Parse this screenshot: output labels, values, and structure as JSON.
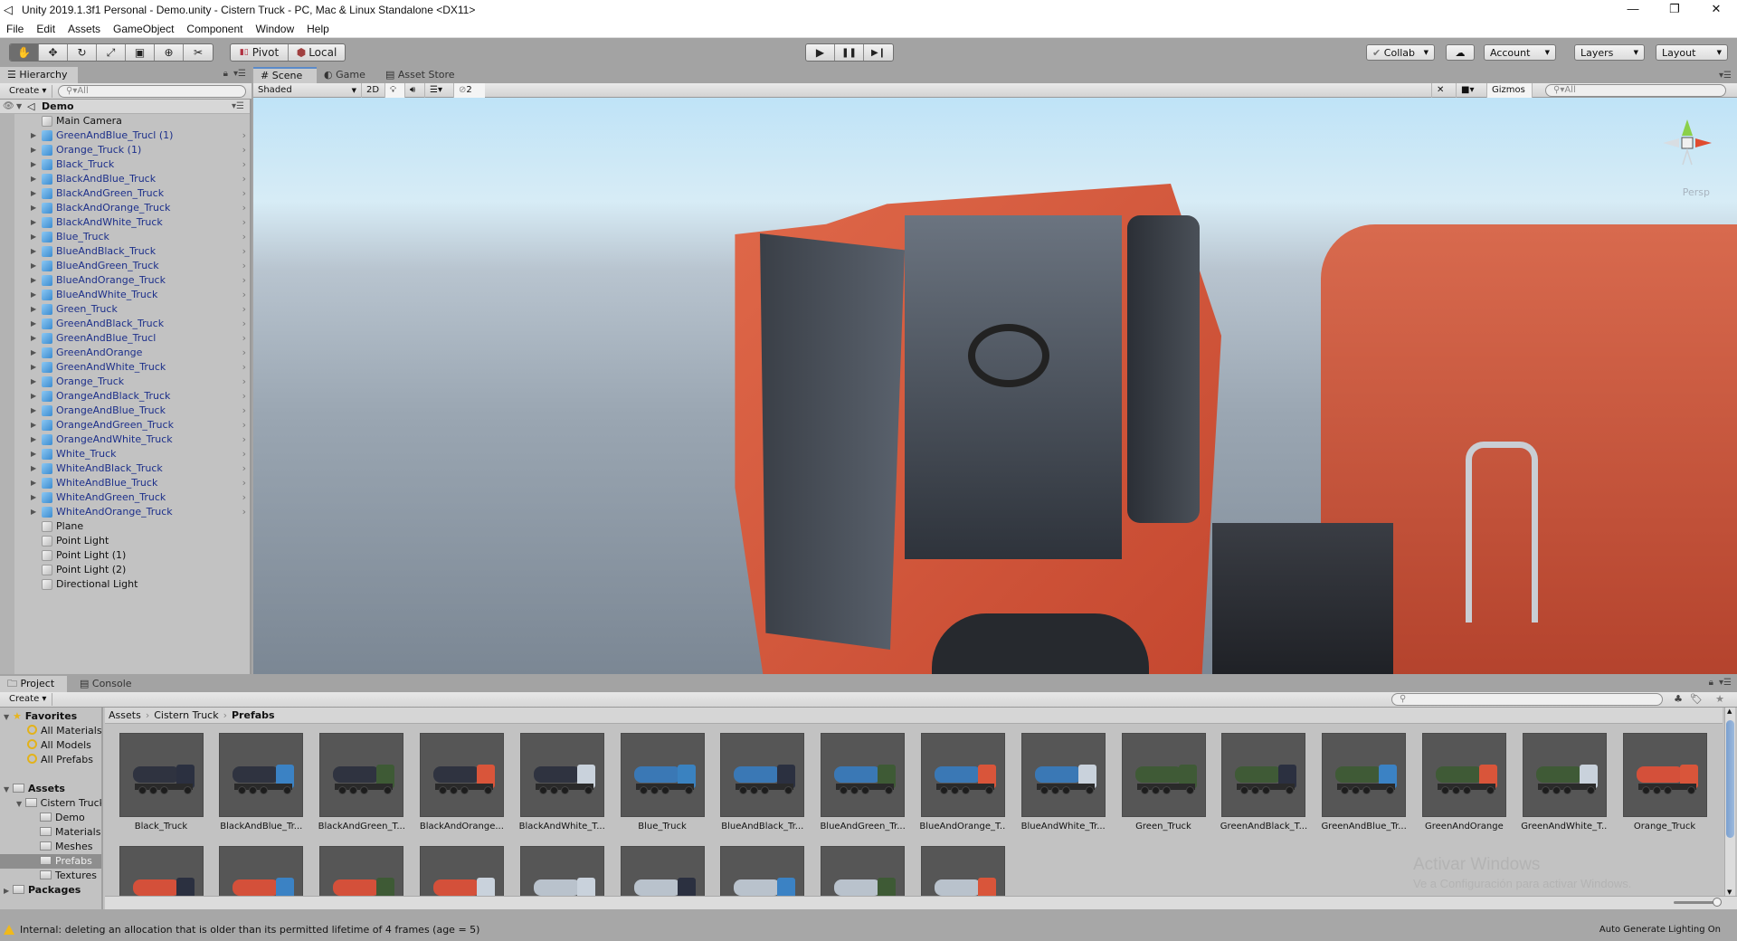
{
  "window": {
    "title": "Unity 2019.1.3f1 Personal - Demo.unity - Cistern Truck - PC, Mac & Linux Standalone <DX11>",
    "controls": {
      "minimize": "—",
      "restore": "❐",
      "close": "✕"
    }
  },
  "menu": [
    "File",
    "Edit",
    "Assets",
    "GameObject",
    "Component",
    "Window",
    "Help"
  ],
  "toolbar": {
    "tools": [
      {
        "name": "hand-tool",
        "glyph": "✋",
        "active": true
      },
      {
        "name": "move-tool",
        "glyph": "✥",
        "active": false
      },
      {
        "name": "rotate-tool",
        "glyph": "↻",
        "active": false
      },
      {
        "name": "scale-tool",
        "glyph": "⤢",
        "active": false
      },
      {
        "name": "rect-tool",
        "glyph": "▣",
        "active": false
      },
      {
        "name": "transform-tool",
        "glyph": "⊕",
        "active": false
      },
      {
        "name": "custom-tool",
        "glyph": "✂",
        "active": false
      }
    ],
    "pivot_label": "Pivot",
    "local_label": "Local",
    "play": {
      "play": "▶",
      "pause": "❚❚",
      "step": "▶❙"
    },
    "collab_label": "Collab",
    "cloud_glyph": "☁",
    "account_label": "Account",
    "layers_label": "Layers",
    "layout_label": "Layout"
  },
  "hierarchy": {
    "tab_label": "Hierarchy",
    "create_label": "Create",
    "search_placeholder": "All",
    "scene_name": "Demo",
    "items": [
      {
        "label": "Main Camera",
        "prefab": false,
        "expandable": false
      },
      {
        "label": "GreenAndBlue_Trucl (1)",
        "prefab": true,
        "expandable": true
      },
      {
        "label": "Orange_Truck (1)",
        "prefab": true,
        "expandable": true
      },
      {
        "label": "Black_Truck",
        "prefab": true,
        "expandable": true
      },
      {
        "label": "BlackAndBlue_Truck",
        "prefab": true,
        "expandable": true
      },
      {
        "label": "BlackAndGreen_Truck",
        "prefab": true,
        "expandable": true
      },
      {
        "label": "BlackAndOrange_Truck",
        "prefab": true,
        "expandable": true
      },
      {
        "label": "BlackAndWhite_Truck",
        "prefab": true,
        "expandable": true
      },
      {
        "label": "Blue_Truck",
        "prefab": true,
        "expandable": true
      },
      {
        "label": "BlueAndBlack_Truck",
        "prefab": true,
        "expandable": true
      },
      {
        "label": "BlueAndGreen_Truck",
        "prefab": true,
        "expandable": true
      },
      {
        "label": "BlueAndOrange_Truck",
        "prefab": true,
        "expandable": true
      },
      {
        "label": "BlueAndWhite_Truck",
        "prefab": true,
        "expandable": true
      },
      {
        "label": "Green_Truck",
        "prefab": true,
        "expandable": true
      },
      {
        "label": "GreenAndBlack_Truck",
        "prefab": true,
        "expandable": true
      },
      {
        "label": "GreenAndBlue_Trucl",
        "prefab": true,
        "expandable": true
      },
      {
        "label": "GreenAndOrange",
        "prefab": true,
        "expandable": true
      },
      {
        "label": "GreenAndWhite_Truck",
        "prefab": true,
        "expandable": true
      },
      {
        "label": "Orange_Truck",
        "prefab": true,
        "expandable": true
      },
      {
        "label": "OrangeAndBlack_Truck",
        "prefab": true,
        "expandable": true
      },
      {
        "label": "OrangeAndBlue_Truck",
        "prefab": true,
        "expandable": true
      },
      {
        "label": "OrangeAndGreen_Truck",
        "prefab": true,
        "expandable": true
      },
      {
        "label": "OrangeAndWhite_Truck",
        "prefab": true,
        "expandable": true
      },
      {
        "label": "White_Truck",
        "prefab": true,
        "expandable": true
      },
      {
        "label": "WhiteAndBlack_Truck",
        "prefab": true,
        "expandable": true
      },
      {
        "label": "WhiteAndBlue_Truck",
        "prefab": true,
        "expandable": true
      },
      {
        "label": "WhiteAndGreen_Truck",
        "prefab": true,
        "expandable": true
      },
      {
        "label": "WhiteAndOrange_Truck",
        "prefab": true,
        "expandable": true
      },
      {
        "label": "Plane",
        "prefab": false,
        "expandable": false
      },
      {
        "label": "Point Light",
        "prefab": false,
        "expandable": false
      },
      {
        "label": "Point Light (1)",
        "prefab": false,
        "expandable": false
      },
      {
        "label": "Point Light (2)",
        "prefab": false,
        "expandable": false
      },
      {
        "label": "Directional Light",
        "prefab": false,
        "expandable": false
      }
    ]
  },
  "scene": {
    "tabs": [
      {
        "label": "Scene",
        "icon": "#",
        "selected": true
      },
      {
        "label": "Game",
        "icon": "◐",
        "selected": false
      },
      {
        "label": "Asset Store",
        "icon": "▤",
        "selected": false
      }
    ],
    "shading_mode": "Shaded",
    "mode_2d_label": "2D",
    "hidden_count": "2",
    "gizmos_label": "Gizmos",
    "search_placeholder": "All",
    "projection_label": "Persp"
  },
  "project": {
    "tabs": [
      {
        "label": "Project",
        "selected": true
      },
      {
        "label": "Console",
        "selected": false
      }
    ],
    "create_label": "Create",
    "tree": {
      "favorites_label": "Favorites",
      "favorites": [
        "All Materials",
        "All Models",
        "All Prefabs"
      ],
      "assets_label": "Assets",
      "cistern_label": "Cistern Truck",
      "folders": [
        "Demo",
        "Materials",
        "Meshes",
        "Prefabs",
        "Textures"
      ],
      "selected_folder": "Prefabs",
      "packages_label": "Packages"
    },
    "breadcrumb": [
      "Assets",
      "Cistern Truck",
      "Prefabs"
    ],
    "assets_row1": [
      {
        "name": "Black_Truck",
        "tank": "#2f3340",
        "cab": "#2b3040"
      },
      {
        "name": "BlackAndBlue_Tr...",
        "tank": "#2f3340",
        "cab": "#3b82c4"
      },
      {
        "name": "BlackAndGreen_T...",
        "tank": "#2f3340",
        "cab": "#3e5a35"
      },
      {
        "name": "BlackAndOrange...",
        "tank": "#2f3340",
        "cab": "#d9553a"
      },
      {
        "name": "BlackAndWhite_T...",
        "tank": "#2f3340",
        "cab": "#c9d2dc"
      },
      {
        "name": "Blue_Truck",
        "tank": "#3a78b5",
        "cab": "#3a82c0"
      },
      {
        "name": "BlueAndBlack_Tr...",
        "tank": "#3a78b5",
        "cab": "#2b3040"
      },
      {
        "name": "BlueAndGreen_Tr...",
        "tank": "#3a78b5",
        "cab": "#3e5a35"
      },
      {
        "name": "BlueAndOrange_T...",
        "tank": "#3a78b5",
        "cab": "#d9553a"
      },
      {
        "name": "BlueAndWhite_Tr...",
        "tank": "#3a78b5",
        "cab": "#c9d2dc"
      },
      {
        "name": "Green_Truck",
        "tank": "#3f5a36",
        "cab": "#3f5a36"
      },
      {
        "name": "GreenAndBlack_T...",
        "tank": "#3f5a36",
        "cab": "#2b3040"
      },
      {
        "name": "GreenAndBlue_Tr...",
        "tank": "#3f5a36",
        "cab": "#3b82c4"
      },
      {
        "name": "GreenAndOrange",
        "tank": "#3f5a36",
        "cab": "#d9553a"
      },
      {
        "name": "GreenAndWhite_T...",
        "tank": "#3f5a36",
        "cab": "#c9d2dc"
      },
      {
        "name": "Orange_Truck",
        "tank": "#d4503a",
        "cab": "#d9553a"
      }
    ],
    "assets_row2": [
      {
        "tank": "#d4503a",
        "cab": "#2b3040"
      },
      {
        "tank": "#d4503a",
        "cab": "#3b82c4"
      },
      {
        "tank": "#d4503a",
        "cab": "#3e5a35"
      },
      {
        "tank": "#d4503a",
        "cab": "#c9d2dc"
      },
      {
        "tank": "#b9c2cc",
        "cab": "#c9d2dc"
      },
      {
        "tank": "#b9c2cc",
        "cab": "#2b3040"
      },
      {
        "tank": "#b9c2cc",
        "cab": "#3b82c4"
      },
      {
        "tank": "#b9c2cc",
        "cab": "#3e5a35"
      },
      {
        "tank": "#b9c2cc",
        "cab": "#d9553a"
      }
    ]
  },
  "watermark": {
    "line1": "Activar Windows",
    "line2": "Ve a Configuración para activar Windows."
  },
  "status": {
    "message": "Internal: deleting an allocation that is older than its permitted lifetime of 4 frames (age = 5)",
    "lighting": "Auto Generate Lighting On"
  },
  "colors": {
    "accent_tab": "#5a8ac8",
    "prefab_text": "#1c2f8a",
    "truck_orange": "#d9583d",
    "warning": "#f0b91a"
  }
}
